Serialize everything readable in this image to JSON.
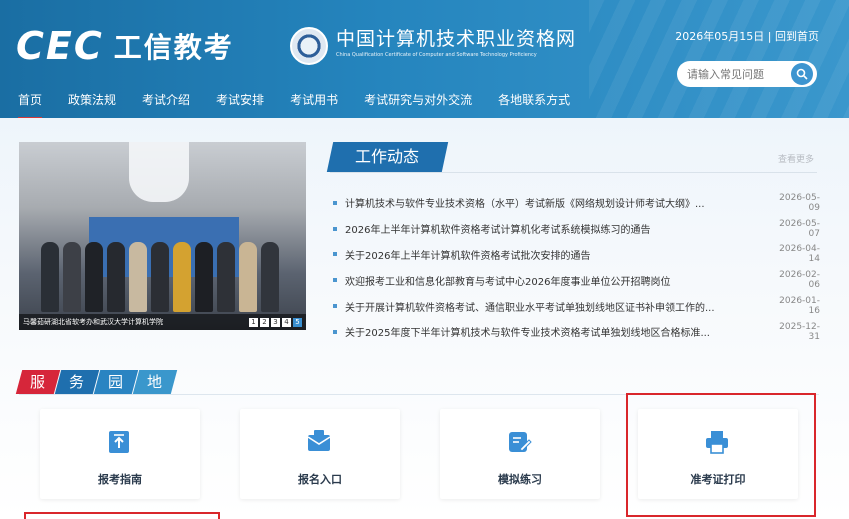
{
  "header": {
    "logo_cec": "CEC",
    "logo_title": "工信教考",
    "site_name_cn": "中国计算机技术职业资格网",
    "site_name_en": "China Qualification Certificate of Computer and Software Technology Proficiency",
    "date": "2026年05月15日",
    "back_home": "回到首页",
    "search_placeholder": "请输入常见问题"
  },
  "nav": [
    {
      "label": "首页",
      "active": true
    },
    {
      "label": "政策法规"
    },
    {
      "label": "考试介绍"
    },
    {
      "label": "考试安排"
    },
    {
      "label": "考试用书"
    },
    {
      "label": "考试研究与对外交流"
    },
    {
      "label": "各地联系方式"
    }
  ],
  "slider": {
    "caption": "马馨茹研湖北省软考办和武汉大学计算机学院",
    "pages": [
      "1",
      "2",
      "3",
      "4",
      "5"
    ],
    "current_page": "5"
  },
  "news": {
    "tab": "工作动态",
    "more": "查看更多",
    "items": [
      {
        "title": "计算机技术与软件专业技术资格（水平）考试新版《网络规划设计师考试大纲》...",
        "date": "2026-05-09"
      },
      {
        "title": "2026年上半年计算机软件资格考试计算机化考试系统模拟练习的通告",
        "date": "2026-05-07"
      },
      {
        "title": "关于2026年上半年计算机软件资格考试批次安排的通告",
        "date": "2026-04-14"
      },
      {
        "title": "欢迎报考工业和信息化部教育与考试中心2026年度事业单位公开招聘岗位",
        "date": "2026-02-06"
      },
      {
        "title": "关于开展计算机软件资格考试、通信职业水平考试单独划线地区证书补申领工作的...",
        "date": "2026-01-16"
      },
      {
        "title": "关于2025年度下半年计算机技术与软件专业技术资格考试单独划线地区合格标准...",
        "date": "2025-12-31"
      }
    ]
  },
  "services": {
    "title_chars": [
      "服",
      "务",
      "园",
      "地"
    ],
    "cards": [
      {
        "label": "报考指南",
        "icon": "guide-icon"
      },
      {
        "label": "报名入口",
        "icon": "registration-icon"
      },
      {
        "label": "模拟练习",
        "icon": "practice-icon"
      },
      {
        "label": "准考证打印",
        "icon": "printer-icon"
      }
    ]
  },
  "colors": {
    "header": "#2585be",
    "nav_active": "#d53a3a",
    "service_red": "#d6263a",
    "service_blue": "#1f6fae",
    "highlight": "#d9262b"
  }
}
